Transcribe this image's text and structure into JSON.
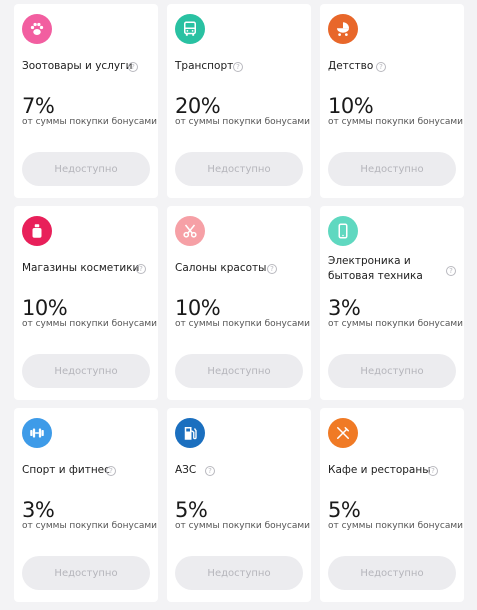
{
  "cards": [
    {
      "title": "Зоотовары и услуги",
      "percent": "7%",
      "subtitle": "от суммы покупки бонусами",
      "button_label": "Недоступно",
      "icon": "paw-icon",
      "color": "#f25ea0"
    },
    {
      "title": "Транспорт",
      "percent": "20%",
      "subtitle": "от суммы покупки бонусами",
      "button_label": "Недоступно",
      "icon": "bus-icon",
      "color": "#29c1a2"
    },
    {
      "title": "Детство",
      "percent": "10%",
      "subtitle": "от суммы покупки бонусами",
      "button_label": "Недоступно",
      "icon": "stroller-icon",
      "color": "#e8672a"
    },
    {
      "title": "Магазины косметики",
      "percent": "10%",
      "subtitle": "от суммы покупки бонусами",
      "button_label": "Недоступно",
      "icon": "perfume-icon",
      "color": "#e8205a"
    },
    {
      "title": "Салоны красоты",
      "percent": "10%",
      "subtitle": "от суммы покупки бонусами",
      "button_label": "Недоступно",
      "icon": "scissors-icon",
      "color": "#f6a0a6"
    },
    {
      "title": "Электроника и бытовая техника",
      "percent": "3%",
      "subtitle": "от суммы покупки бонусами",
      "button_label": "Недоступно",
      "icon": "smartphone-icon",
      "color": "#5fd8c0"
    },
    {
      "title": "Спорт и фитнес",
      "percent": "3%",
      "subtitle": "от суммы покупки бонусами",
      "button_label": "Недоступно",
      "icon": "dumbbell-icon",
      "color": "#3e9be8"
    },
    {
      "title": "АЗС",
      "percent": "5%",
      "subtitle": "от суммы покупки бонусами",
      "button_label": "Недоступно",
      "icon": "fuel-pump-icon",
      "color": "#1b6fbf"
    },
    {
      "title": "Кафе и рестораны",
      "percent": "5%",
      "subtitle": "от суммы покупки бонусами",
      "button_label": "Недоступно",
      "icon": "cutlery-icon",
      "color": "#f07a25"
    }
  ],
  "help_glyph": "?"
}
